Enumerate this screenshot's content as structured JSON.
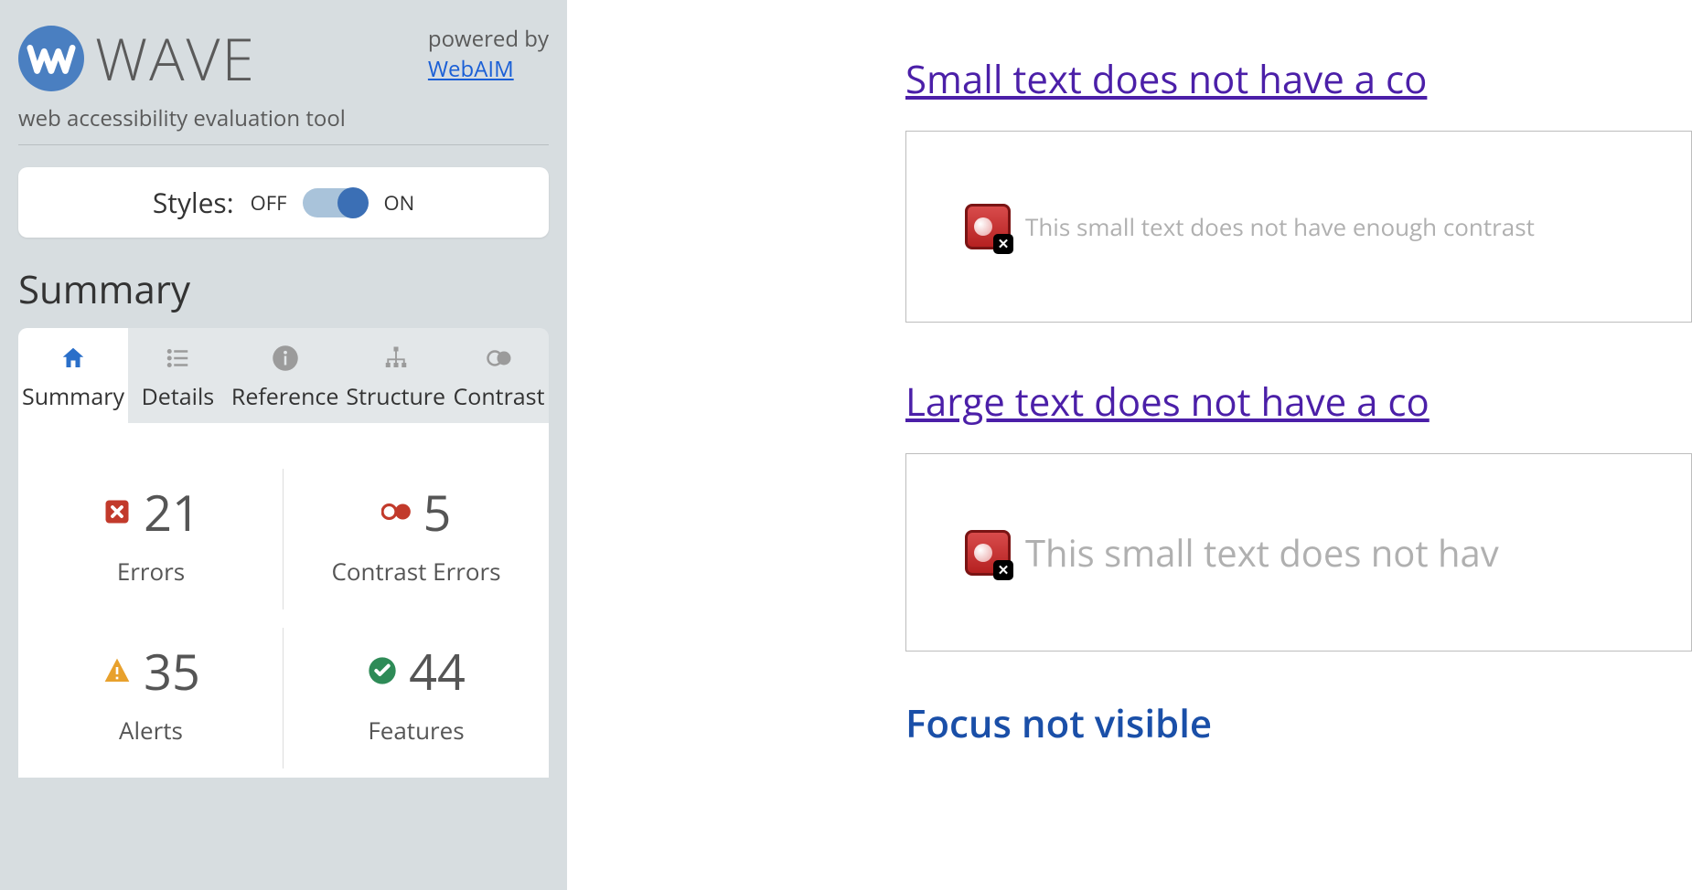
{
  "brand": {
    "name": "WAVE",
    "tagline": "web accessibility evaluation tool",
    "powered_prefix": "powered by",
    "powered_link": "WebAIM"
  },
  "styles": {
    "label": "Styles:",
    "off": "OFF",
    "on": "ON",
    "state": "on"
  },
  "summary_title": "Summary",
  "tabs": [
    {
      "id": "summary",
      "label": "Summary",
      "active": true
    },
    {
      "id": "details",
      "label": "Details",
      "active": false
    },
    {
      "id": "reference",
      "label": "Reference",
      "active": false
    },
    {
      "id": "structure",
      "label": "Structure",
      "active": false
    },
    {
      "id": "contrast",
      "label": "Contrast",
      "active": false
    }
  ],
  "stats": {
    "errors": {
      "count": "21",
      "label": "Errors"
    },
    "contrast": {
      "count": "5",
      "label": "Contrast Errors"
    },
    "alerts": {
      "count": "35",
      "label": "Alerts"
    },
    "features": {
      "count": "44",
      "label": "Features"
    }
  },
  "content": {
    "heading1": "Small text does not have a co",
    "box1_text": "This small text does not have enough contrast",
    "heading2": "Large text does not have a co",
    "box2_text": "This small text does not hav",
    "heading3": "Focus not visible"
  }
}
